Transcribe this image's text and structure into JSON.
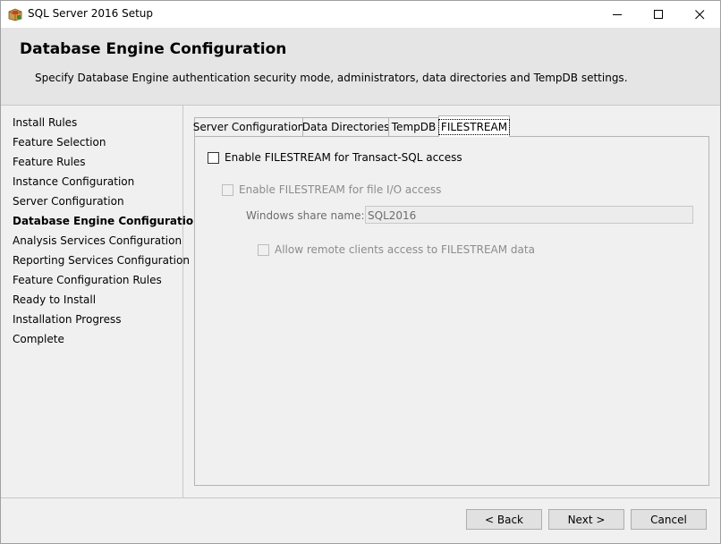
{
  "window": {
    "title": "SQL Server 2016 Setup",
    "icon": "sql-setup-box-icon"
  },
  "header": {
    "title": "Database Engine Configuration",
    "description": "Specify Database Engine authentication security mode, administrators, data directories and TempDB settings."
  },
  "nav": {
    "items": [
      {
        "label": "Install Rules",
        "active": false
      },
      {
        "label": "Feature Selection",
        "active": false
      },
      {
        "label": "Feature Rules",
        "active": false
      },
      {
        "label": "Instance Configuration",
        "active": false
      },
      {
        "label": "Server Configuration",
        "active": false
      },
      {
        "label": "Database Engine Configuration",
        "active": true
      },
      {
        "label": "Analysis Services Configuration",
        "active": false
      },
      {
        "label": "Reporting Services Configuration",
        "active": false
      },
      {
        "label": "Feature Configuration Rules",
        "active": false
      },
      {
        "label": "Ready to Install",
        "active": false
      },
      {
        "label": "Installation Progress",
        "active": false
      },
      {
        "label": "Complete",
        "active": false
      }
    ]
  },
  "tabs": [
    {
      "label": "Server Configuration",
      "selected": false
    },
    {
      "label": "Data Directories",
      "selected": false
    },
    {
      "label": "TempDB",
      "selected": false
    },
    {
      "label": "FILESTREAM",
      "selected": true
    }
  ],
  "filestream": {
    "enable_tsql": {
      "label": "Enable FILESTREAM for Transact-SQL access",
      "checked": false
    },
    "enable_file_io": {
      "label": "Enable FILESTREAM for file I/O access",
      "checked": false,
      "disabled": true
    },
    "share_name_label": "Windows share name:",
    "share_name_value": "SQL2016",
    "allow_remote": {
      "label": "Allow remote clients access to FILESTREAM data",
      "checked": false,
      "disabled": true
    }
  },
  "buttons": {
    "back": "< Back",
    "next": "Next >",
    "cancel": "Cancel"
  }
}
